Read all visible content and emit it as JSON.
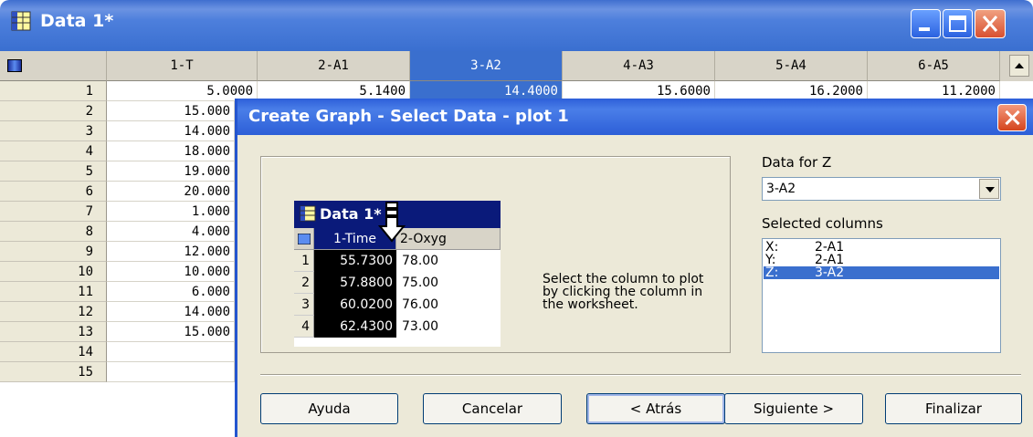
{
  "window": {
    "title": "Data 1*"
  },
  "worksheet": {
    "columns": [
      "1-T",
      "2-A1",
      "3-A2",
      "4-A3",
      "5-A4",
      "6-A5"
    ],
    "rows": [
      [
        "1",
        "5.0000",
        "5.1400",
        "14.4000",
        "15.6000",
        "16.2000",
        "11.2000"
      ],
      [
        "2",
        "15.000"
      ],
      [
        "3",
        "14.000"
      ],
      [
        "4",
        "18.000"
      ],
      [
        "5",
        "19.000"
      ],
      [
        "6",
        "20.000"
      ],
      [
        "7",
        "1.000"
      ],
      [
        "8",
        "4.000"
      ],
      [
        "9",
        "12.000"
      ],
      [
        "10",
        "10.000"
      ],
      [
        "11",
        "6.000"
      ],
      [
        "12",
        "14.000"
      ],
      [
        "13",
        "15.000"
      ],
      [
        "14",
        ""
      ],
      [
        "15",
        ""
      ]
    ]
  },
  "dialog": {
    "title": "Create Graph - Select Data - plot 1",
    "mini": {
      "title": "Data 1*",
      "headers": [
        "1-Time",
        "2-Oxyg"
      ],
      "rows": [
        [
          "1",
          "55.7300",
          "78.00"
        ],
        [
          "2",
          "57.8800",
          "75.00"
        ],
        [
          "3",
          "60.0200",
          "76.00"
        ],
        [
          "4",
          "62.4300",
          "73.00"
        ]
      ]
    },
    "instruction": "Select the column to plot by clicking the column in the worksheet.",
    "data_for_z_label": "Data for Z",
    "data_for_z_value": "3-A2",
    "selected_columns_label": "Selected columns",
    "selected_columns": [
      {
        "axis": "X:",
        "col": "2-A1"
      },
      {
        "axis": "Y:",
        "col": "2-A1"
      },
      {
        "axis": "Z:",
        "col": "3-A2"
      }
    ],
    "buttons": {
      "help": "Ayuda",
      "cancel": "Cancelar",
      "back": "< Atrás",
      "next": "Siguiente >",
      "finish": "Finalizar"
    }
  }
}
